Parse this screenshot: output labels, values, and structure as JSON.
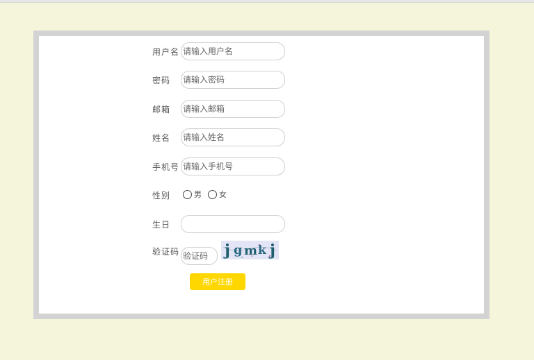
{
  "form": {
    "fields": [
      {
        "label": "用户名",
        "placeholder": "请输入用户名"
      },
      {
        "label": "密码",
        "placeholder": "请输入密码"
      },
      {
        "label": "邮箱",
        "placeholder": "请输入邮箱"
      },
      {
        "label": "姓名",
        "placeholder": "请输入姓名"
      },
      {
        "label": "手机号",
        "placeholder": "请输入手机号"
      }
    ],
    "gender": {
      "label": "性别",
      "options": [
        "男",
        "女"
      ]
    },
    "birthday": {
      "label": "生日",
      "value": ""
    },
    "captcha": {
      "label": "验证码",
      "placeholder": "验证码",
      "image_text": "jgmkj"
    },
    "submit_label": "用户注册"
  },
  "colors": {
    "page_bg": "#f5f5dc",
    "frame": "#d3d3d3",
    "button": "#ffd700"
  }
}
